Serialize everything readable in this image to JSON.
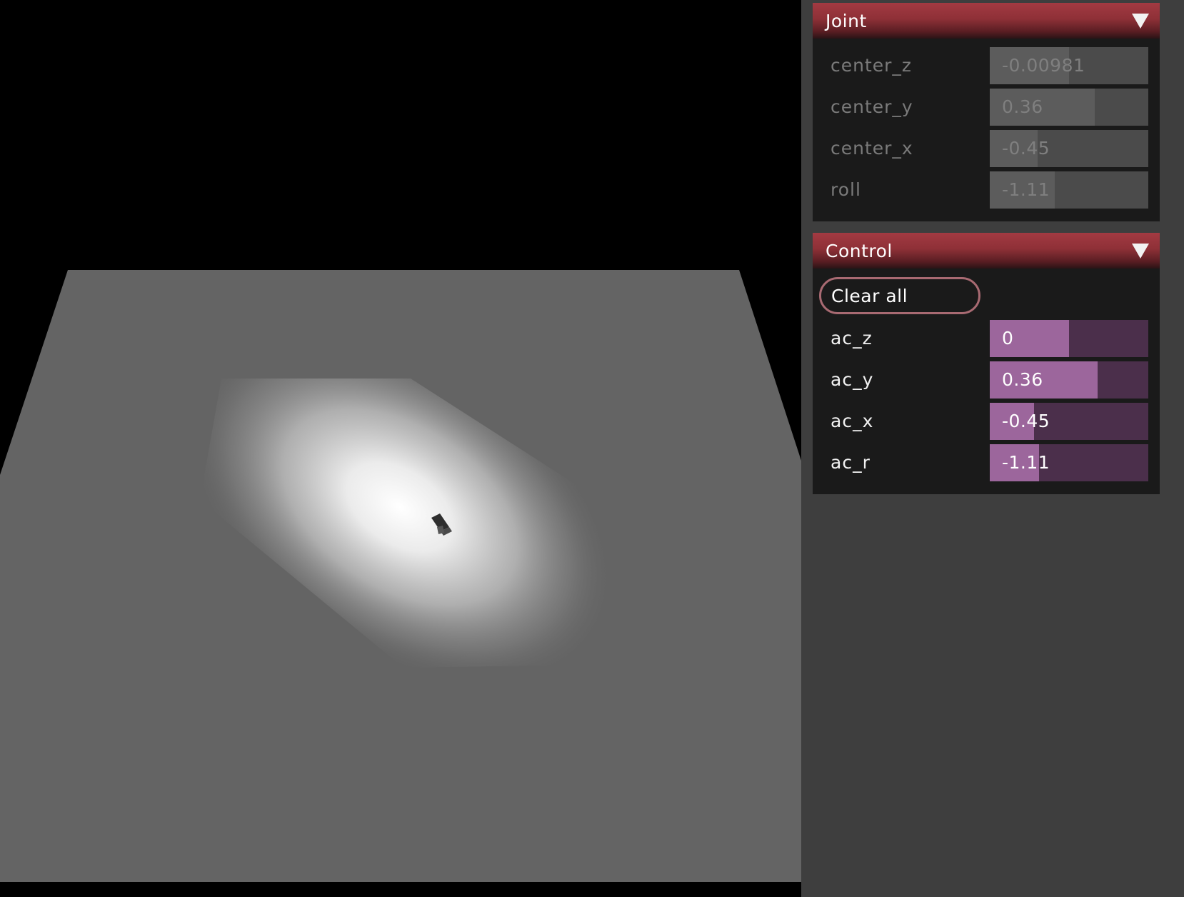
{
  "viewport": {
    "floor_color": "#646464",
    "highlight_color": "#ffffff",
    "background_color": "#000000"
  },
  "joint": {
    "title": "Joint",
    "rows": [
      {
        "label": "center_z",
        "value": "-0.00981",
        "fill_fraction": 0.5
      },
      {
        "label": "center_y",
        "value": "0.36",
        "fill_fraction": 0.66
      },
      {
        "label": "center_x",
        "value": "-0.45",
        "fill_fraction": 0.3
      },
      {
        "label": "roll",
        "value": "-1.11",
        "fill_fraction": 0.41
      }
    ]
  },
  "control": {
    "title": "Control",
    "clear_all_label": "Clear all",
    "rows": [
      {
        "label": "ac_z",
        "value": "0",
        "fill_fraction": 0.5
      },
      {
        "label": "ac_y",
        "value": "0.36",
        "fill_fraction": 0.68
      },
      {
        "label": "ac_x",
        "value": "-0.45",
        "fill_fraction": 0.28
      },
      {
        "label": "ac_r",
        "value": "-1.11",
        "fill_fraction": 0.31
      }
    ]
  },
  "colors": {
    "header_red": "#a33a42",
    "control_fill": "#9c669c",
    "control_track": "#4b2f4b",
    "panel_bg": "#1a1a1a",
    "side_bg": "#3e3e3e"
  }
}
